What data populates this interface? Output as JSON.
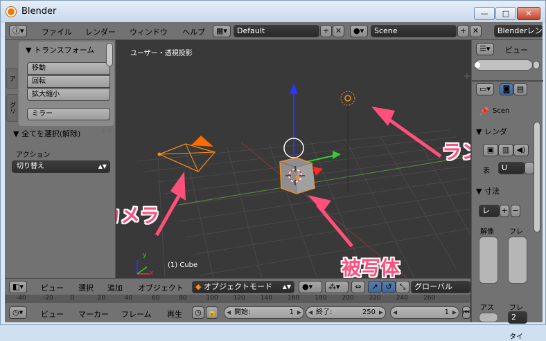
{
  "window": {
    "title": "Blender",
    "min": "—",
    "max": "□",
    "close": "✕"
  },
  "info_header": {
    "menus": [
      "ファイル",
      "レンダー",
      "ウィンドウ",
      "ヘルプ"
    ],
    "screen": "Default",
    "scene": "Scene",
    "engine": "Blenderレン"
  },
  "toolshelf": {
    "tabs": [
      "ア",
      "グリ"
    ],
    "transform_title": "▼ トランスフォーム",
    "buttons": [
      "移動",
      "回転",
      "拡大縮小"
    ],
    "mirror": "ミラー",
    "operator_title": "▼ 全てを選択(解除)",
    "action_label": "アクション",
    "action_value": "切り替え"
  },
  "viewport": {
    "view_label": "ユーザー・透視投影",
    "object_label": "(1) Cube",
    "axis_x": "x",
    "axis_y": "y",
    "annotations": {
      "camera": "カメラ",
      "lamp": "ランプ",
      "object": "被写体"
    }
  },
  "outliner": {
    "view_menu": "ビュー"
  },
  "properties": {
    "scene_item": "Scen",
    "render_title": "▼ レンダ",
    "display_label": "表",
    "display_value": "U",
    "dimensions_title": "▼ 寸法",
    "preset_value": "レ",
    "resolution_label": "解像",
    "frame_label": "フレ",
    "aspect_label": "アス",
    "frame_rate_label": "フレ",
    "frame_rate_value": "2",
    "time_label": "タイ"
  },
  "view3d_header": {
    "menus": [
      "ビュー",
      "選択",
      "追加",
      "オブジェクト"
    ],
    "mode": "オブジェクトモード",
    "orientation": "グローバル"
  },
  "ruler": [
    "-40",
    "-20",
    "0",
    "20",
    "40",
    "60",
    "80",
    "100",
    "120",
    "140",
    "160",
    "180",
    "200",
    "220",
    "240",
    "260"
  ],
  "timeline": {
    "menus": [
      "ビュー",
      "マーカー",
      "フレーム",
      "再生"
    ],
    "start_label": "開始:",
    "start_value": "1",
    "end_label": "終了:",
    "end_value": "250",
    "current_value": "1"
  },
  "colors": {
    "accent": "#e87d0d",
    "annotation": "#ff4f7b",
    "selection": "#ff8c1a"
  }
}
